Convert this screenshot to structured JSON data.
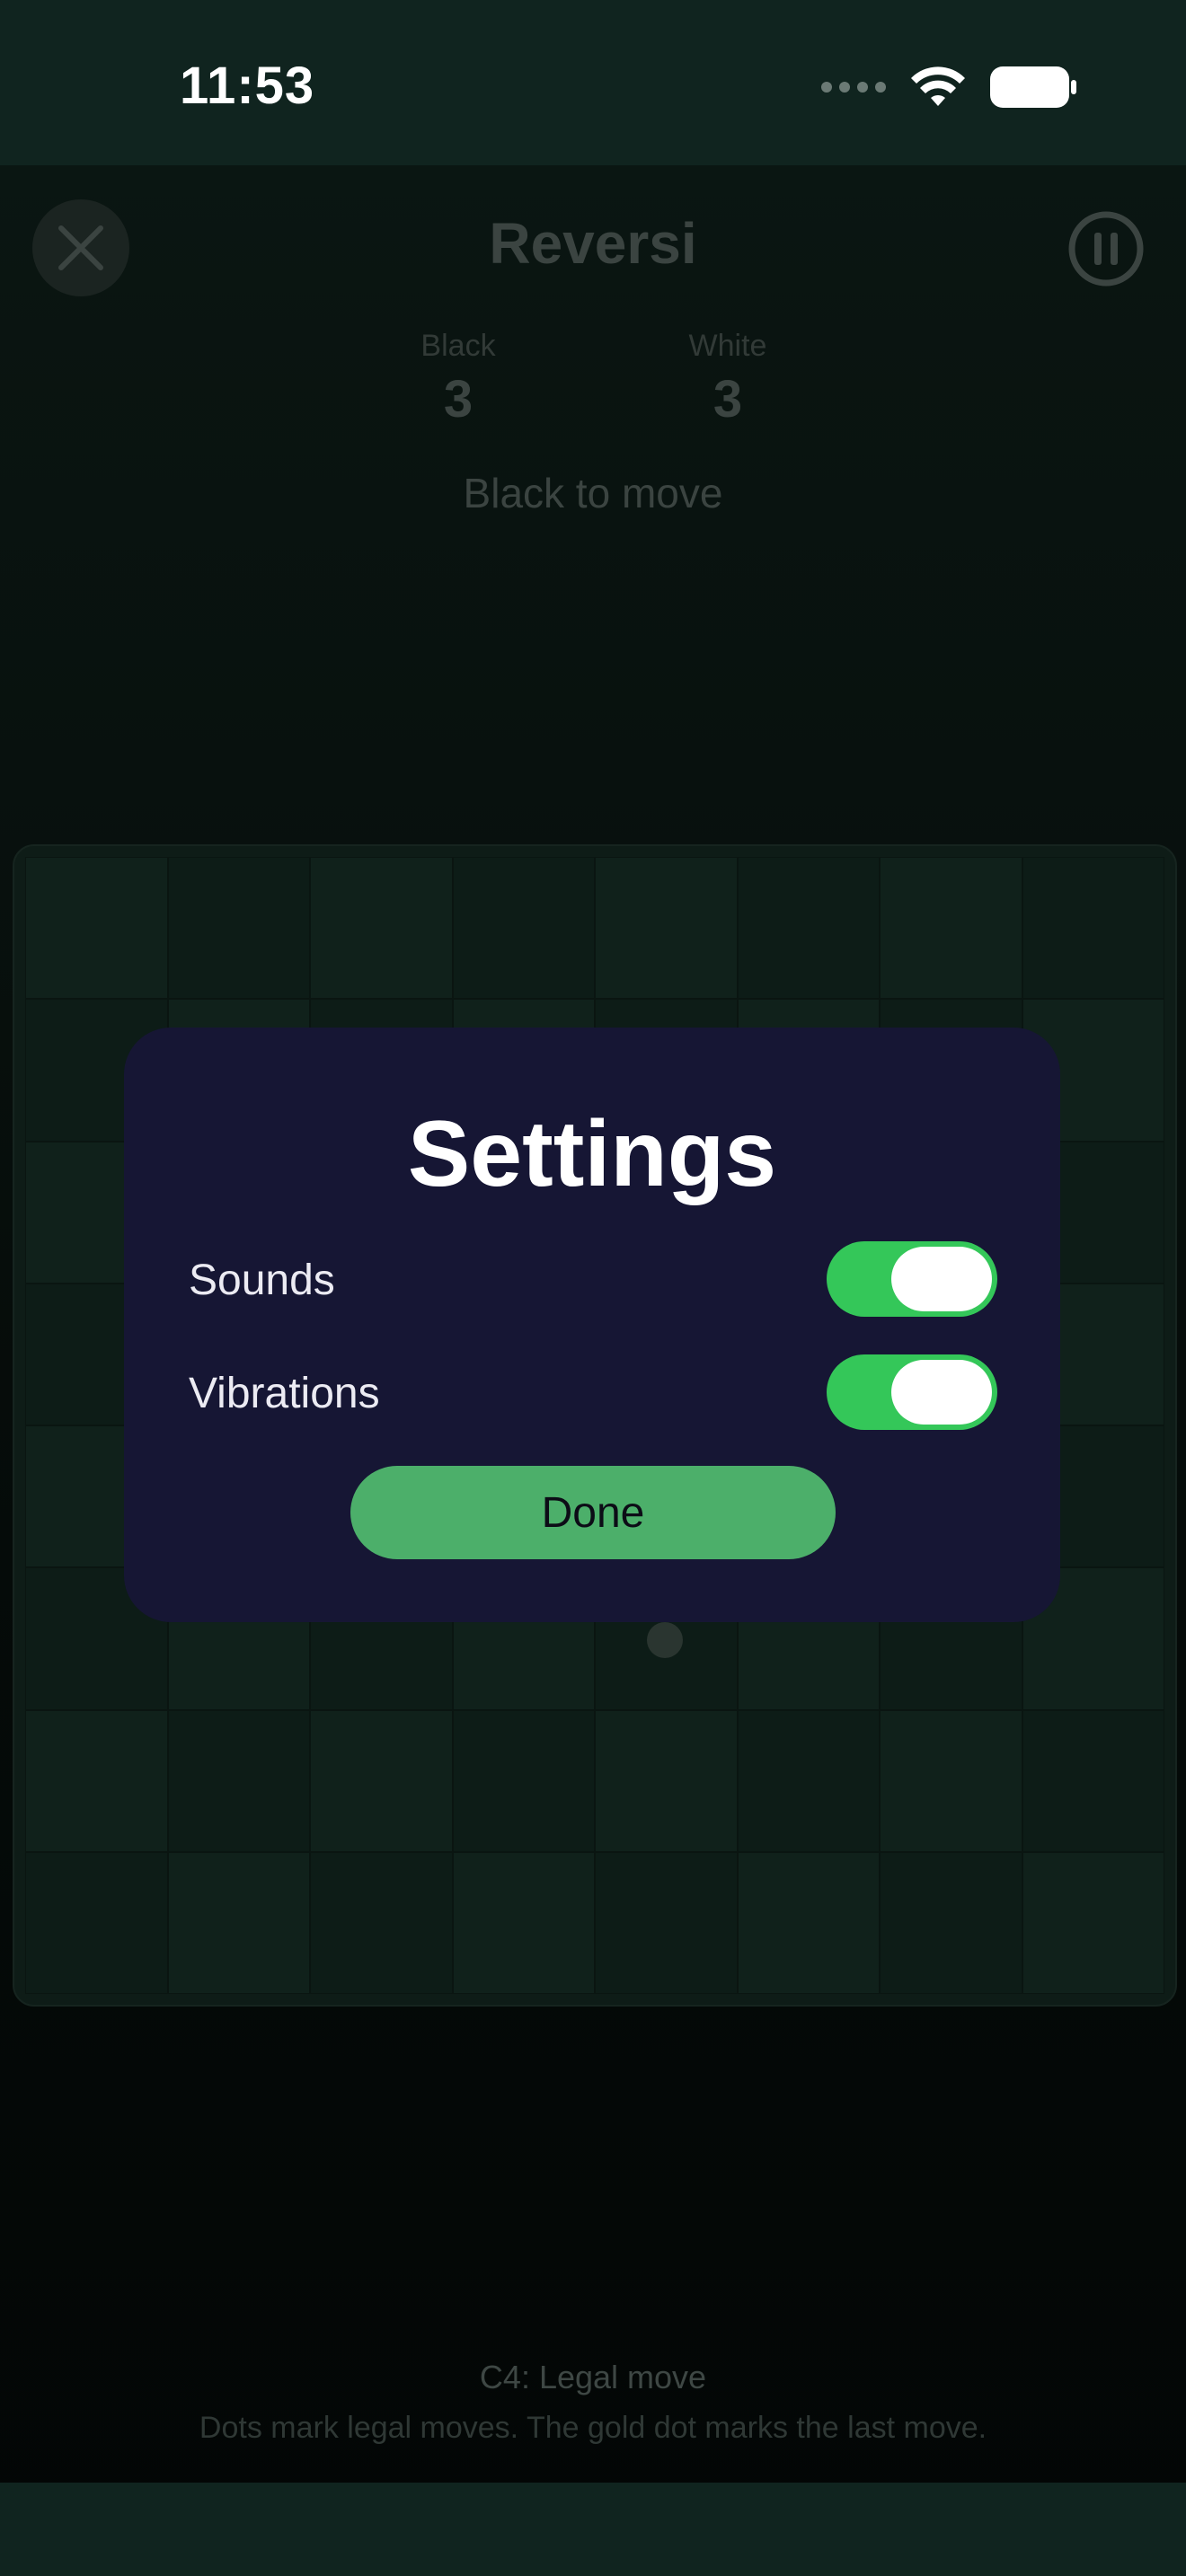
{
  "status_bar": {
    "time": "11:53"
  },
  "header": {
    "title": "Reversi"
  },
  "scores": {
    "black": {
      "label": "Black",
      "value": "3"
    },
    "white": {
      "label": "White",
      "value": "3"
    }
  },
  "turn_text": "Black to move",
  "settings_modal": {
    "title": "Settings",
    "rows": [
      {
        "label": "Sounds",
        "on": true
      },
      {
        "label": "Vibrations",
        "on": true
      }
    ],
    "done_label": "Done"
  },
  "footer": {
    "last_move": "C4: Legal move",
    "hint": "Dots mark legal moves. The gold dot marks the last move."
  },
  "colors": {
    "toggle_on": "#34c759",
    "done_button": "#4caf6a",
    "modal_bg": "#161634"
  }
}
